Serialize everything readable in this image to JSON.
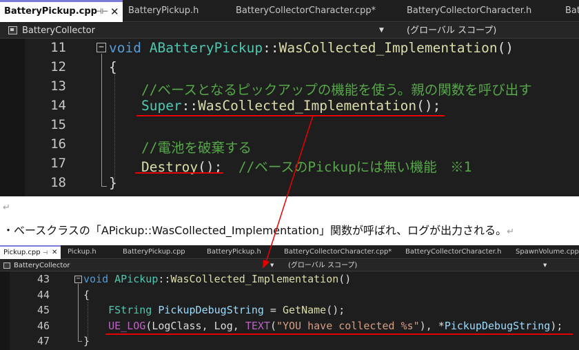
{
  "top_editor": {
    "tabs": [
      {
        "label": "BatteryPickup.cpp",
        "active": true
      },
      {
        "label": "BatteryPickup.h"
      },
      {
        "label": "BatteryCollectorCharacter.cpp*"
      },
      {
        "label": "BatteryCollectorCharacter.h"
      },
      {
        "label": "Batter"
      }
    ],
    "pin_glyph": "⊣⊢",
    "close_glyph": "✕",
    "project": "BatteryCollector",
    "scope": "(グローバル スコープ)",
    "lines": [
      {
        "num": "11",
        "tokens": [
          {
            "t": "void",
            "c": "k-blue"
          },
          {
            "t": " "
          },
          {
            "t": "ABatteryPickup",
            "c": "k-teal"
          },
          {
            "t": "::"
          },
          {
            "t": "WasCollected_Implementation",
            "c": "k-fn"
          },
          {
            "t": "()"
          }
        ]
      },
      {
        "num": "12",
        "tokens": [
          {
            "t": "{"
          }
        ]
      },
      {
        "num": "13",
        "tokens": [
          {
            "t": "    "
          },
          {
            "t": "//ベースとなるピックアップの機能を使う。親の関数を呼び出す",
            "c": "k-cm"
          }
        ]
      },
      {
        "num": "14",
        "tokens": [
          {
            "t": "    "
          },
          {
            "t": "Super",
            "c": "k-teal"
          },
          {
            "t": "::"
          },
          {
            "t": "WasCollected_Implementation",
            "c": "k-fn"
          },
          {
            "t": "();"
          }
        ]
      },
      {
        "num": "15",
        "tokens": []
      },
      {
        "num": "16",
        "tokens": [
          {
            "t": "    "
          },
          {
            "t": "//電池を破棄する",
            "c": "k-cm"
          }
        ]
      },
      {
        "num": "17",
        "tokens": [
          {
            "t": "    "
          },
          {
            "t": "Destroy",
            "c": "k-fn"
          },
          {
            "t": "();  "
          },
          {
            "t": "//ベースのPickupには無い機能　※1",
            "c": "k-cm"
          }
        ]
      },
      {
        "num": "18",
        "tokens": [
          {
            "t": "}"
          }
        ]
      }
    ]
  },
  "return_mark": "↵",
  "description": "・ベースクラスの「APickup::WasCollected_Implementation」関数が呼ばれ、ログが出力される。",
  "bottom_editor": {
    "tabs": [
      {
        "label": "Pickup.cpp",
        "active": true
      },
      {
        "label": "Pickup.h"
      },
      {
        "label": "BatteryPickup.cpp"
      },
      {
        "label": "BatteryPickup.h"
      },
      {
        "label": "BatteryCollectorCharacter.cpp*"
      },
      {
        "label": "BatteryCollectorCharacter.h"
      },
      {
        "label": "SpawnVolume.cpp"
      }
    ],
    "pin_glyph": "⊣",
    "close_glyph": "✕",
    "project": "BatteryCollector",
    "scope": "(グローバル スコープ)",
    "lines": [
      {
        "num": "43",
        "tokens": [
          {
            "t": "void",
            "c": "k-blue"
          },
          {
            "t": " "
          },
          {
            "t": "APickup",
            "c": "k-teal"
          },
          {
            "t": "::"
          },
          {
            "t": "WasCollected_Implementation",
            "c": "k-fn"
          },
          {
            "t": "()"
          }
        ]
      },
      {
        "num": "44",
        "tokens": [
          {
            "t": "{"
          }
        ]
      },
      {
        "num": "45",
        "tokens": [
          {
            "t": "    "
          },
          {
            "t": "FString",
            "c": "k-teal"
          },
          {
            "t": " "
          },
          {
            "t": "PickupDebugString",
            "c": "k-var"
          },
          {
            "t": " = "
          },
          {
            "t": "GetName",
            "c": "k-fn"
          },
          {
            "t": "();"
          }
        ]
      },
      {
        "num": "46",
        "tokens": [
          {
            "t": "    "
          },
          {
            "t": "UE_LOG",
            "c": "k-mac"
          },
          {
            "t": "("
          },
          {
            "t": "LogClass",
            "c": "k-def"
          },
          {
            "t": ", "
          },
          {
            "t": "Log",
            "c": "k-def"
          },
          {
            "t": ", "
          },
          {
            "t": "TEXT",
            "c": "k-mac"
          },
          {
            "t": "("
          },
          {
            "t": "\"YOU have collected %s\"",
            "c": "k-str"
          },
          {
            "t": "), *"
          },
          {
            "t": "PickupDebugString",
            "c": "k-var"
          },
          {
            "t": ");"
          }
        ]
      },
      {
        "num": "47",
        "tokens": [
          {
            "t": "}"
          }
        ]
      }
    ]
  },
  "colors": {
    "editor_bg": "#1e1e1e",
    "keyword": "#569cd6",
    "type": "#4ec9b0",
    "function": "#dcdcaa",
    "comment": "#57a64a",
    "annotation": "#e60000"
  }
}
